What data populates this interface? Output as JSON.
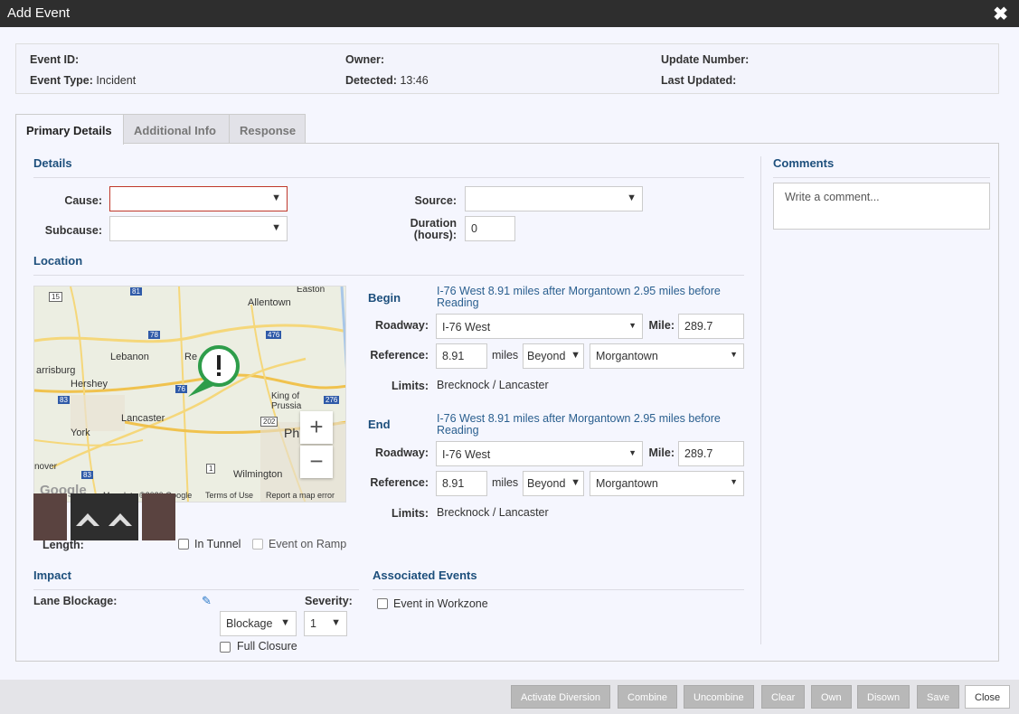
{
  "window": {
    "title": "Add Event"
  },
  "info": {
    "event_id_label": "Event ID:",
    "event_type_label": "Event Type:",
    "event_type_value": "Incident",
    "owner_label": "Owner:",
    "detected_label": "Detected:",
    "detected_value": "13:46",
    "update_number_label": "Update Number:",
    "last_updated_label": "Last Updated:"
  },
  "tabs": [
    {
      "label": "Primary Details",
      "active": true
    },
    {
      "label": "Additional Info",
      "active": false
    },
    {
      "label": "Response",
      "active": false
    }
  ],
  "details": {
    "title": "Details",
    "cause_label": "Cause:",
    "cause_value": "",
    "subcause_label": "Subcause:",
    "subcause_value": "",
    "source_label": "Source:",
    "source_value": "",
    "duration_label_line1": "Duration",
    "duration_label_line2": "(hours):",
    "duration_value": "0"
  },
  "comments": {
    "title": "Comments",
    "placeholder": "Write a comment..."
  },
  "location": {
    "title": "Location",
    "map": {
      "cities": [
        "Allentown",
        "Easton",
        "Lebanon",
        "Hershey",
        "arrisburg",
        "Lancaster",
        "York",
        "King of Prussia",
        "Phil",
        "Wilmington",
        "nover",
        "Re"
      ],
      "route_shields": [
        "15",
        "81",
        "78",
        "476",
        "83",
        "76",
        "202",
        "276",
        "1",
        "83"
      ],
      "attribution": "Map data ©2020 Google",
      "terms": "Terms of Use",
      "report": "Report a map error",
      "logo": "Google",
      "zoom_in": "+",
      "zoom_out": "−"
    },
    "length_label": "Length:",
    "in_tunnel_label": "In Tunnel",
    "event_on_ramp_label": "Event on Ramp",
    "begin": {
      "title": "Begin",
      "description": "I-76 West 8.91 miles after Morgantown 2.95 miles before Reading",
      "roadway_label": "Roadway:",
      "roadway_value": "I-76 West",
      "mile_label": "Mile:",
      "mile_value": "289.7",
      "reference_label": "Reference:",
      "reference_value": "8.91",
      "miles_label": "miles",
      "direction_value": "Beyond",
      "place_value": "Morgantown",
      "limits_label": "Limits:",
      "limits_value": "Brecknock / Lancaster"
    },
    "end": {
      "title": "End",
      "description": "I-76 West 8.91 miles after Morgantown 2.95 miles before Reading",
      "roadway_label": "Roadway:",
      "roadway_value": "I-76 West",
      "mile_label": "Mile:",
      "mile_value": "289.7",
      "reference_label": "Reference:",
      "reference_value": "8.91",
      "miles_label": "miles",
      "direction_value": "Beyond",
      "place_value": "Morgantown",
      "limits_label": "Limits:",
      "limits_value": "Brecknock / Lancaster"
    }
  },
  "impact": {
    "title": "Impact",
    "lane_blockage_label": "Lane Blockage:",
    "blockage_value": "Blockage",
    "severity_label": "Severity:",
    "severity_value": "1",
    "full_closure_label": "Full Closure"
  },
  "associated": {
    "title": "Associated Events",
    "event_in_workzone_label": "Event in Workzone"
  },
  "footer": {
    "buttons": [
      "Activate Diversion",
      "Combine",
      "Uncombine",
      "Clear",
      "Own",
      "Disown",
      "Save",
      "Close"
    ]
  },
  "colors": {
    "accent": "#1d4f7c",
    "titlebar": "#2e2e2e",
    "error_border": "#c0392b",
    "marker": "#2e9d4a"
  }
}
